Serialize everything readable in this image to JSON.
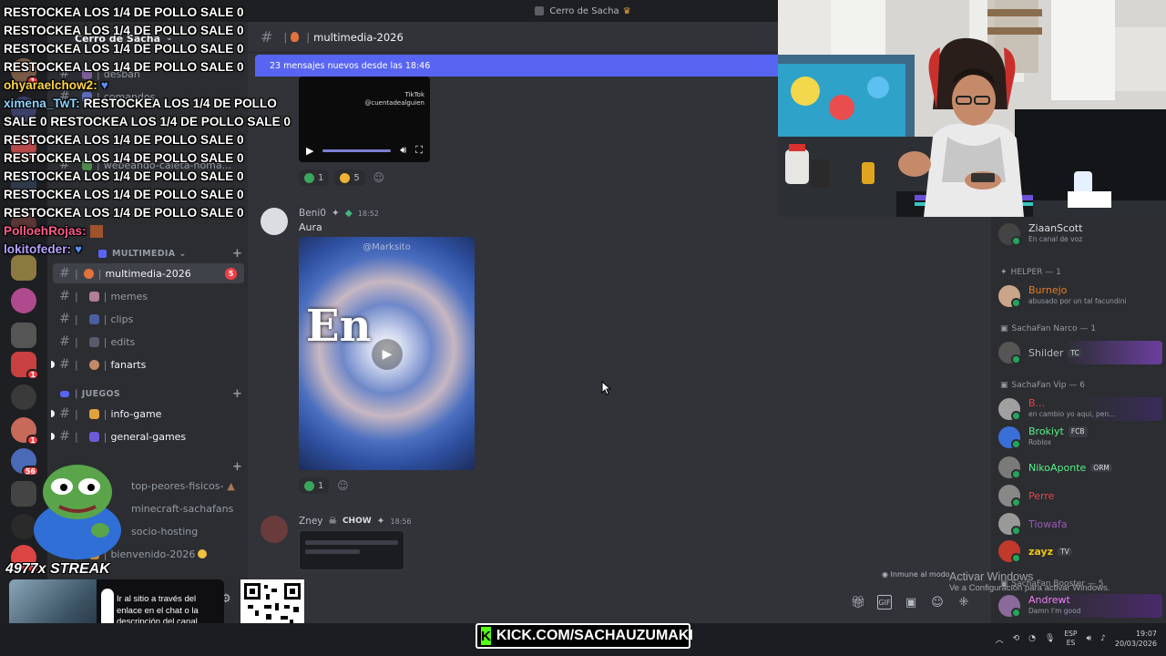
{
  "window": {
    "title": "Cerro de Sacha"
  },
  "server": {
    "name": "Cerro de Sacha"
  },
  "sidebar": {
    "partial_channels": [
      "desban",
      "comandos",
      "webeando-caleta-noma..."
    ],
    "categories": {
      "multimedia": "MULTIMEDIA",
      "juegos": "JUEGOS"
    },
    "channels": [
      {
        "name": "multimedia-2026",
        "badge": "5"
      },
      {
        "name": "memes"
      },
      {
        "name": "clips"
      },
      {
        "name": "edits"
      },
      {
        "name": "fanarts"
      },
      {
        "name": "info-game"
      },
      {
        "name": "general-games"
      },
      {
        "name": "top-peores-fisicos-"
      },
      {
        "name": "minecraft-sachafans"
      },
      {
        "name": "socio-hosting"
      },
      {
        "name": "bienvenido-2026"
      }
    ],
    "server_badges": [
      "1",
      "1",
      "1",
      "1",
      "56"
    ]
  },
  "chat": {
    "channel_name": "multimedia-2026",
    "new_messages_bar": "23 mensajes nuevos desde las 18:46",
    "video_watermark_brand": "TikTok",
    "video_watermark_user": "@cuentadealguien",
    "reactions_1": [
      {
        "count": "1",
        "color": "#3ba55d"
      },
      {
        "count": "5",
        "color": "#f0b232"
      }
    ],
    "messages": [
      {
        "author": "Beni0",
        "time": "18:52",
        "text": "Aura",
        "image_watermark": "@Marksito",
        "image_overlay_text": "En",
        "reaction_count": "1"
      },
      {
        "author": "Zney",
        "tag": "CHOW",
        "time": "18:56"
      }
    ],
    "immune_text": "Inmune al modo"
  },
  "members": {
    "top_member": {
      "name": "ZiaanScott",
      "status": "En canal de voz"
    },
    "groups": [
      {
        "label": "HELPER — 1",
        "members": [
          {
            "name": "Burnejo",
            "color": "#e67e22",
            "sub": "abusado por un tal facundini"
          }
        ]
      },
      {
        "label": "SachaFan Narco — 1",
        "members": [
          {
            "name": "Shilder",
            "color": "#b5bac1",
            "tag": "TC"
          }
        ]
      },
      {
        "label": "SachaFan Vip — 6",
        "members": [
          {
            "name": "B...",
            "color": "#ed4245",
            "sub": "en cambio yo aqui, pen..."
          },
          {
            "name": "Brokiyt",
            "color": "#57f287",
            "tag": "FCB",
            "sub": "Roblox"
          },
          {
            "name": "NikoAponte",
            "color": "#57f287",
            "tag": "ORM"
          },
          {
            "name": "Perre",
            "color": "#ed4245"
          },
          {
            "name": "Tiowafa",
            "color": "#9b59b6"
          },
          {
            "name": "zayz",
            "color": "#f1c40f",
            "tag": "TV"
          }
        ]
      },
      {
        "label": "SachaFan Booster — 5",
        "members": [
          {
            "name": "Andrewt",
            "color": "#f47fff",
            "sub": "Damn I'm good"
          }
        ]
      }
    ]
  },
  "stream_overlay": {
    "chat_lines": [
      {
        "user": "",
        "text": "RESTOCKEA LOS 1/4 DE POLLO SALE 0"
      },
      {
        "user": "",
        "text": "RESTOCKEA LOS 1/4 DE POLLO SALE 0"
      },
      {
        "user": "",
        "text": "RESTOCKEA LOS 1/4 DE POLLO SALE 0"
      },
      {
        "user": "",
        "text": "RESTOCKEA LOS 1/4 DE POLLO SALE 0"
      },
      {
        "user": "ohyaraelchow2:",
        "user_color": "#ffd54a",
        "text": ""
      },
      {
        "user": "ximena_TwT:",
        "user_color": "#8fd3ff",
        "text": "RESTOCKEA LOS 1/4 DE POLLO"
      },
      {
        "user": "",
        "text": "SALE 0 RESTOCKEA LOS 1/4 DE POLLO SALE 0"
      },
      {
        "user": "",
        "text": "RESTOCKEA LOS 1/4 DE POLLO SALE 0"
      },
      {
        "user": "",
        "text": "RESTOCKEA LOS 1/4 DE POLLO SALE 0"
      },
      {
        "user": "",
        "text": "RESTOCKEA LOS 1/4 DE POLLO SALE 0"
      },
      {
        "user": "",
        "text": "RESTOCKEA LOS 1/4 DE POLLO SALE 0"
      },
      {
        "user": "",
        "text": "RESTOCKEA LOS 1/4 DE POLLO SALE 0"
      },
      {
        "user": "PolloehRojas:",
        "user_color": "#ff5c8a",
        "text": ""
      },
      {
        "user": "lokitofeder:",
        "user_color": "#b6a4ff",
        "text": ""
      }
    ],
    "streak": "4977x STREAK",
    "promo_text": "Ir al sitio a través del enlace en el chat o la descripción del canal",
    "kick_url": "KICK.COM/SACHAUZUMAKI"
  },
  "windows": {
    "activate_title": "Activar Windows",
    "activate_sub": "Ve a Configuración para activar Windows.",
    "lang_top": "ESP",
    "lang_bottom": "ES",
    "time": "19:07",
    "date": "20/03/2026"
  }
}
